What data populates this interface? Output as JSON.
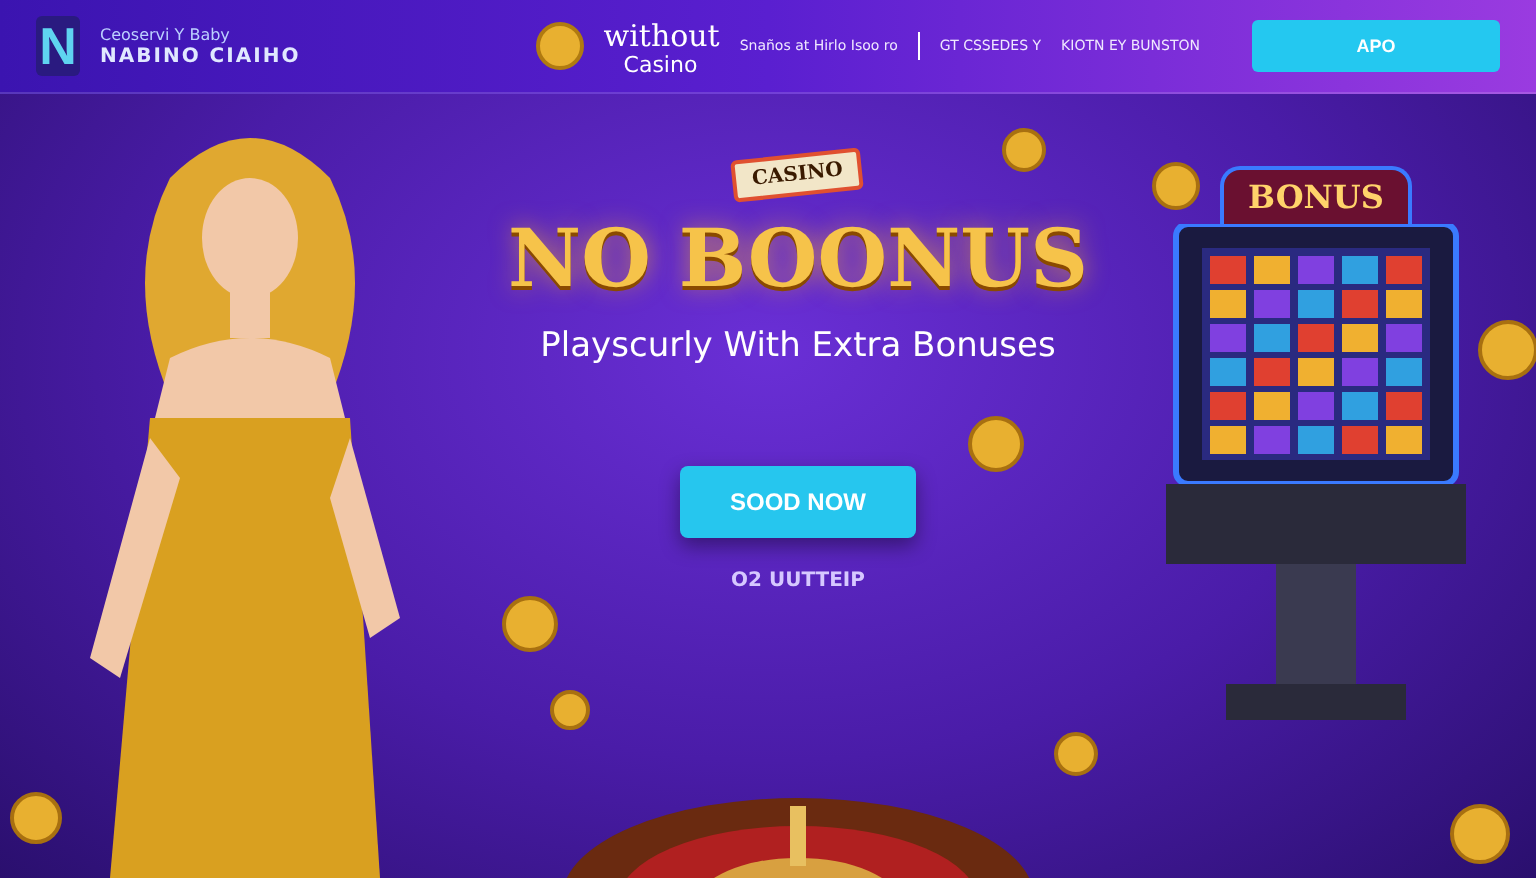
{
  "header": {
    "logo_letter": "N",
    "logo_top": "Ceoservi Y Baby",
    "logo_main": "NABINO CIAIHO",
    "brand_word": "without",
    "brand_sub": "Casino",
    "nav": [
      {
        "label": "Snaños at Hirlo Isoo ro"
      },
      {
        "label": "GT CSSEDES Y"
      },
      {
        "label": "KIOTN EY BUNSTON"
      }
    ],
    "cta": "APO"
  },
  "hero": {
    "sign": "CASINO",
    "headline": "NO BOONUS",
    "subtitle": "Playscurly With Extra Bonuses",
    "button": "SOOD NOW",
    "link": "O2 UUTTEIP"
  },
  "slot": {
    "sign": "BONUS"
  }
}
